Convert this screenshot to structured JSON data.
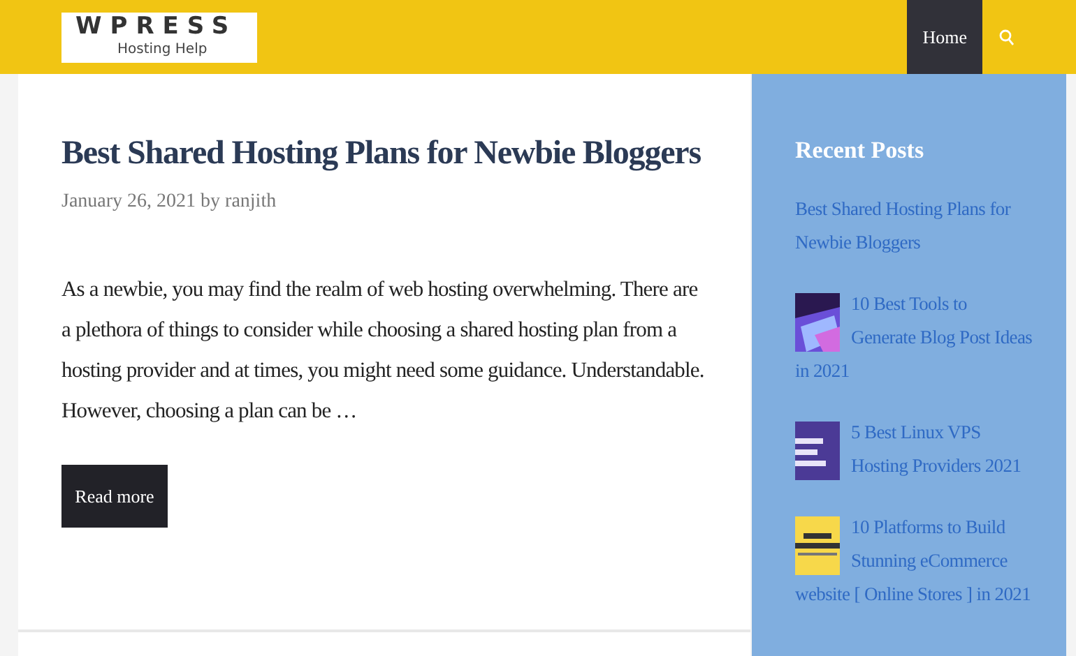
{
  "header": {
    "logo": {
      "title": "WPRESS",
      "subtitle": "Hosting Help"
    },
    "nav": [
      {
        "label": "Home",
        "selected": true
      }
    ]
  },
  "post": {
    "title": "Best Shared Hosting Plans for Newbie Bloggers",
    "meta": "January 26, 2021 by ranjith",
    "excerpt": "As a newbie, you may find the realm of web hosting overwhelming. There are a plethora of things to consider while choosing a shared hosting plan from a hosting provider and at times, you might need some guidance. Understandable. However, choosing a plan can be …",
    "button": "Read more"
  },
  "sidebar": {
    "title": "Recent Posts",
    "items": [
      {
        "title": "Best Shared Hosting Plans for Newbie Bloggers"
      },
      {
        "title": "10 Best Tools to Generate Blog Post Ideas in 2021"
      },
      {
        "title": "5 Best Linux VPS Hosting Providers 2021"
      },
      {
        "title": "10 Platforms to Build Stunning eCommerce website [ Online Stores ] in 2021"
      }
    ]
  }
}
